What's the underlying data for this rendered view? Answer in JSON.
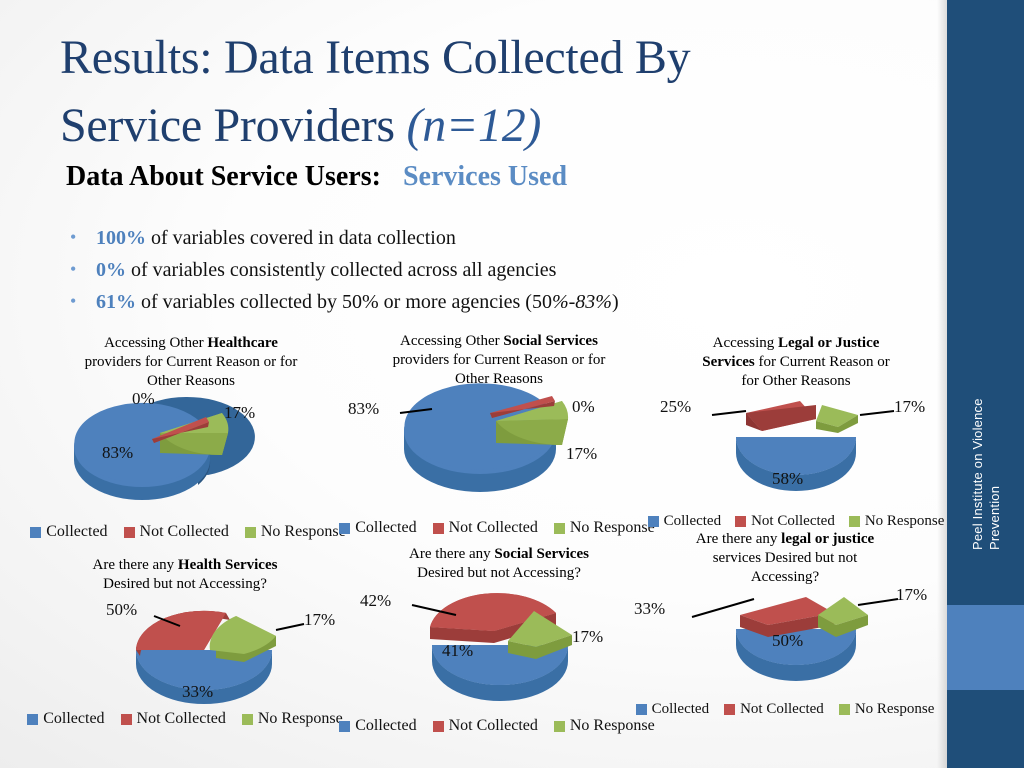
{
  "slide": {
    "title_line1": "Results: Data Items Collected By",
    "title_line2_plain": "Service Providers ",
    "title_line2_italic": "(n=12)",
    "subtitle_main": "Data About Service Users:",
    "subtitle_accent": "Services Used",
    "sidebar_label": "Peel Institute on Violence Prevention",
    "colors": {
      "title": "#1F3F6E",
      "accent": "#5B8CC4",
      "sidebar_dark": "#1F4E79",
      "sidebar_light": "#4E81BD",
      "series_collected": "#4E81BD",
      "series_not_collected": "#C0504D",
      "series_no_response": "#9BBB59"
    }
  },
  "bullets": [
    {
      "pct": "100%",
      "text": " of variables covered in data collection",
      "range": ""
    },
    {
      "pct": "0%",
      "text": " of variables consistently collected across all agencies",
      "range": ""
    },
    {
      "pct": "61%",
      "text": " of variables collected by 50% or more agencies (50",
      "range": "%-83%",
      "tail": ")"
    }
  ],
  "legend": {
    "collected": "Collected",
    "not_collected": "Not Collected",
    "no_response": "No Response"
  },
  "chart_data": [
    {
      "id": "healthcare-access",
      "type": "pie",
      "title_parts": [
        "Accessing Other ",
        "Healthcare",
        " providers for Current Reason or for Other Reasons"
      ],
      "title_plain": "Accessing Other Healthcare providers for Current Reason or for Other Reasons",
      "categories": [
        "Collected",
        "Not Collected",
        "No Response"
      ],
      "values": [
        83,
        0,
        17
      ],
      "labels": [
        "83%",
        "0%",
        "17%"
      ],
      "legend_position": "bottom"
    },
    {
      "id": "social-services-access",
      "type": "pie",
      "title_parts": [
        "Accessing Other ",
        "Social Services",
        " providers for Current Reason or for Other Reasons"
      ],
      "title_plain": "Accessing Other Social Services providers for Current Reason or for Other Reasons",
      "categories": [
        "Collected",
        "Not Collected",
        "No Response"
      ],
      "values": [
        83,
        0,
        17
      ],
      "labels": [
        "83%",
        "0%",
        "17%"
      ],
      "legend_position": "bottom"
    },
    {
      "id": "legal-justice-access",
      "type": "pie",
      "title_parts": [
        "Accessing ",
        "Legal or Justice Services",
        " for Current Reason or for Other Reasons"
      ],
      "title_plain": "Accessing Legal or Justice Services for Current Reason or for Other Reasons",
      "categories": [
        "Collected",
        "Not Collected",
        "No Response"
      ],
      "values": [
        58,
        25,
        17
      ],
      "labels": [
        "58%",
        "25%",
        "17%"
      ],
      "legend_position": "bottom"
    },
    {
      "id": "health-services-desired",
      "type": "pie",
      "title_parts": [
        "Are there any ",
        "Health Services",
        " Desired but not Accessing?"
      ],
      "title_plain": "Are there any Health Services Desired but not Accessing?",
      "categories": [
        "Collected",
        "Not Collected",
        "No Response"
      ],
      "values": [
        33,
        50,
        17
      ],
      "labels": [
        "33%",
        "50%",
        "17%"
      ],
      "legend_position": "bottom"
    },
    {
      "id": "social-services-desired",
      "type": "pie",
      "title_parts": [
        "Are there any ",
        "Social Services",
        " Desired but not Accessing?"
      ],
      "title_plain": "Are there any Social Services Desired but not Accessing?",
      "categories": [
        "Collected",
        "Not Collected",
        "No Response"
      ],
      "values": [
        41,
        42,
        17
      ],
      "labels": [
        "41%",
        "42%",
        "17%"
      ],
      "legend_position": "bottom"
    },
    {
      "id": "legal-justice-desired",
      "type": "pie",
      "title_parts": [
        "Are there any  ",
        "legal or justice",
        " services Desired but not Accessing?"
      ],
      "title_plain": "Are there any legal or justice services Desired but not Accessing?",
      "categories": [
        "Collected",
        "Not Collected",
        "No Response"
      ],
      "values": [
        50,
        33,
        17
      ],
      "labels": [
        "50%",
        "33%",
        "17%"
      ],
      "legend_position": "bottom"
    }
  ],
  "charts": {
    "c1": {
      "t1": "Accessing Other ",
      "t2": "Healthcare",
      "t3": "providers for Current Reason or for",
      "t4": "Other Reasons",
      "lab_blue": "83%",
      "lab_red": "0%",
      "lab_green": "17%"
    },
    "c2": {
      "t1": "Accessing Other ",
      "t2": "Social Services",
      "t3": "providers for Current Reason or for",
      "t4": "Other Reasons",
      "lab_blue": "83%",
      "lab_red": "0%",
      "lab_green": "17%"
    },
    "c3": {
      "t1": "Accessing ",
      "t2": "Legal or Justice",
      "t2b": "Services",
      "t3": " for Current Reason or",
      "t4": "for Other Reasons",
      "lab_blue": "58%",
      "lab_red": "25%",
      "lab_green": "17%"
    },
    "c4": {
      "t1": "Are there any ",
      "t2": "Health Services",
      "t3": "Desired but not Accessing?",
      "lab_blue": "33%",
      "lab_red": "50%",
      "lab_green": "17%"
    },
    "c5": {
      "t1": "Are there any ",
      "t2": "Social Services",
      "t3": "Desired but not Accessing?",
      "lab_blue": "41%",
      "lab_red": "42%",
      "lab_green": "17%"
    },
    "c6": {
      "t1": "Are there any  ",
      "t2": "legal or justice",
      "t3": "services Desired but not",
      "t4": "Accessing?",
      "lab_blue": "50%",
      "lab_red": "33%",
      "lab_green": "17%"
    }
  }
}
